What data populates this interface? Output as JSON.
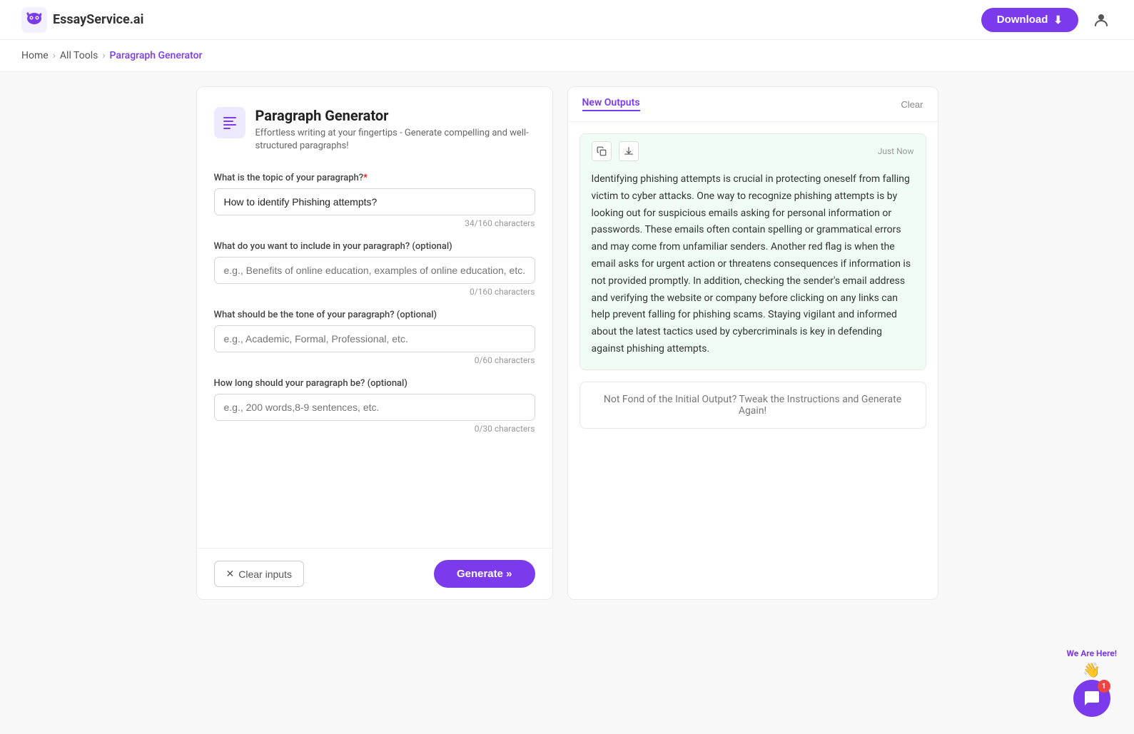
{
  "header": {
    "logo_text": "EssayService.ai",
    "download_label": "Download",
    "download_icon": "⬇"
  },
  "breadcrumb": {
    "items": [
      {
        "label": "Home",
        "active": false
      },
      {
        "label": "All Tools",
        "active": false
      },
      {
        "label": "Paragraph Generator",
        "active": true
      }
    ]
  },
  "tool": {
    "title": "Paragraph Generator",
    "description": "Effortless writing at your fingertips - Generate compelling and well-structured paragraphs!"
  },
  "form": {
    "topic_label": "What is the topic of your paragraph?",
    "topic_required": "*",
    "topic_value": "How to identify Phishing attempts?",
    "topic_char_count": "34/160 characters",
    "include_label": "What do you want to include in your paragraph? (optional)",
    "include_placeholder": "e.g., Benefits of online education, examples of online education, etc.",
    "include_char_count": "0/160 characters",
    "tone_label": "What should be the tone of your paragraph? (optional)",
    "tone_placeholder": "e.g., Academic, Formal, Professional, etc.",
    "tone_char_count": "0/60 characters",
    "length_label": "How long should your paragraph be? (optional)",
    "length_placeholder": "e.g., 200 words,8-9 sentences, etc.",
    "length_char_count": "0/30 characters",
    "clear_label": "Clear inputs",
    "generate_label": "Generate »"
  },
  "output": {
    "tab_label": "New Outputs",
    "clear_label": "Clear",
    "timestamp": "Just Now",
    "output_text": "Identifying phishing attempts is crucial in protecting oneself from falling victim to cyber attacks. One way to recognize phishing attempts is by looking out for suspicious emails asking for personal information or passwords. These emails often contain spelling or grammatical errors and may come from unfamiliar senders. Another red flag is when the email asks for urgent action or threatens consequences if information is not provided promptly. In addition, checking the sender's email address and verifying the website or company before clicking on any links can help prevent falling for phishing scams. Staying vigilant and informed about the latest tactics used by cybercriminals is key in defending against phishing attempts.",
    "regen_hint": "Not Fond of the Initial Output? Tweak the Instructions and Generate Again!"
  },
  "chat_widget": {
    "badge_count": "1",
    "we_are_here_text": "We Are Here!"
  }
}
